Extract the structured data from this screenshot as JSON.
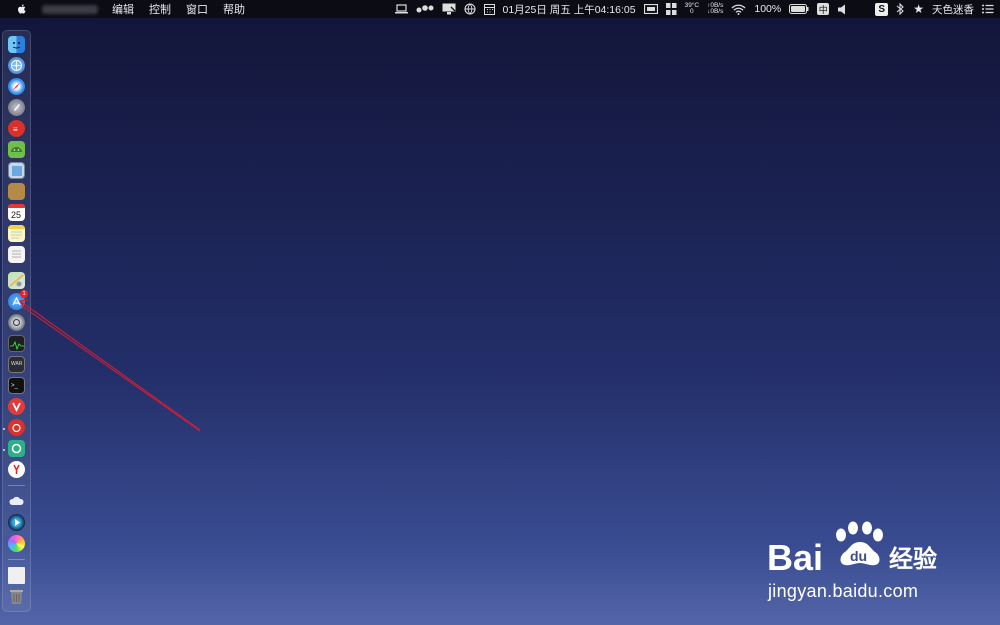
{
  "menubar": {
    "menus": [
      "编辑",
      "控制",
      "窗口",
      "帮助"
    ],
    "datetime": "01月25日 周五 上午04:16:05",
    "temperature": "39°C",
    "temp_sub": "0",
    "net_up": "↑0B/s",
    "net_down": "↓0B/s",
    "battery": "100%",
    "input_method": "中",
    "username": "天色迷香",
    "icons": [
      "apple-icon",
      "laptop-icon",
      "dots-icon",
      "display-icon",
      "globe-icon",
      "calendar-icon",
      "cast-icon",
      "grid-icon",
      "wifi-icon",
      "battery-icon",
      "input-icon",
      "volume-icon",
      "s-app-icon",
      "bluetooth-icon",
      "star-icon",
      "list-icon"
    ]
  },
  "dock": {
    "badge_count": "1",
    "items": [
      "finder",
      "browser",
      "safari",
      "launchpad",
      "app-red",
      "android-studio",
      "preview",
      "notebook",
      "calendar",
      "notes",
      "text-document",
      "maps",
      "app-store",
      "system-preferences",
      "activity-monitor",
      "console",
      "terminal",
      "vivaldi",
      "netease-music",
      "app-green",
      "yandex",
      "icloud",
      "quicktime",
      "photos",
      "document",
      "trash"
    ]
  },
  "watermark": {
    "brand_latin": "Bai",
    "brand_latin_tail": "du",
    "brand_cn": "经验",
    "url": "jingyan.baidu.com"
  },
  "annotation": {
    "arrow_color": "#c0203a"
  }
}
